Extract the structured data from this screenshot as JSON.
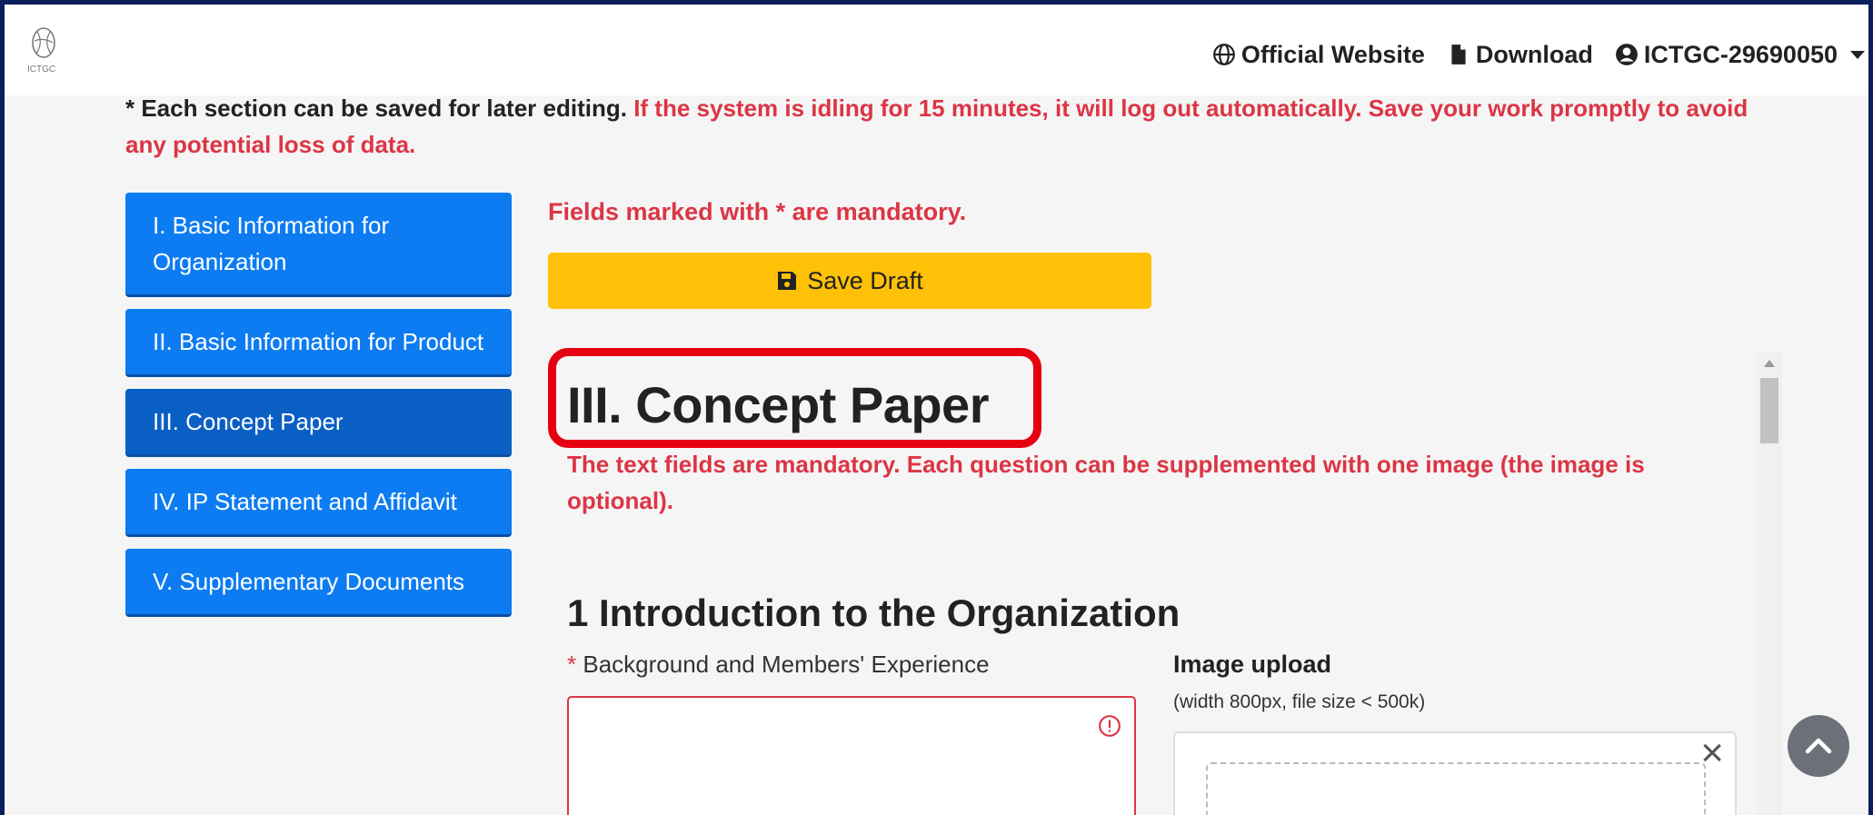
{
  "navbar": {
    "logo_text": "ICTGC",
    "official_website": "Official Website",
    "download": "Download",
    "user": "ICTGC-29690050"
  },
  "notice": {
    "black": "* Each section can be saved for later editing.",
    "red": " If the system is idling for 15 minutes, it will log out automatically. Save your work promptly to avoid any potential loss of data."
  },
  "sidebar": {
    "items": [
      {
        "label": "I. Basic Information for Organization"
      },
      {
        "label": "II. Basic Information for Product"
      },
      {
        "label": "III. Concept Paper"
      },
      {
        "label": "IV. IP Statement and Affidavit"
      },
      {
        "label": "V. Supplementary Documents"
      }
    ]
  },
  "main": {
    "mandatory_note": "Fields marked with * are mandatory.",
    "save_label": "Save Draft",
    "heading": "III. Concept Paper",
    "sub_note": "The text fields are mandatory. Each question can be supplemented with one image (the image is optional).",
    "section_title": "1 Introduction to the Organization",
    "field_star": "*",
    "field_label": "Background and Members' Experience",
    "image_label": "Image upload",
    "image_hint": "(width 800px, file size < 500k)"
  },
  "colors": {
    "primary": "#0d7cf2",
    "active": "#0a5fc4",
    "warning": "#ffc107",
    "danger": "#dc3545",
    "highlight": "#e50012"
  }
}
